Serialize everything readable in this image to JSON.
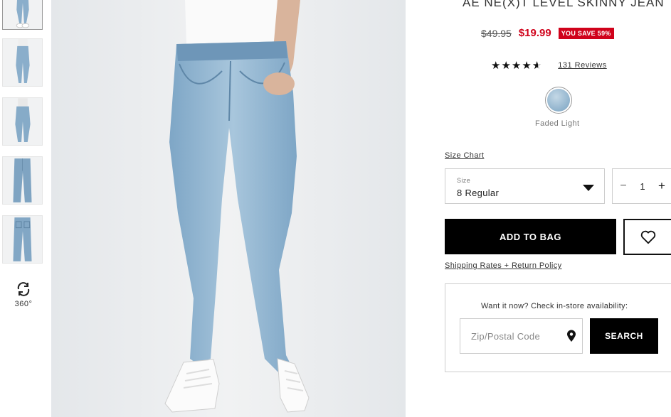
{
  "thumbnails": [
    {
      "name": "thumb-front-full",
      "active": true
    },
    {
      "name": "thumb-side",
      "active": false
    },
    {
      "name": "thumb-back",
      "active": false
    },
    {
      "name": "thumb-flat-front",
      "active": false
    },
    {
      "name": "thumb-flat-back",
      "active": false
    }
  ],
  "rotate": {
    "icon": "rotate-360-icon",
    "label": "360°"
  },
  "product": {
    "title": "AE NE(X)T LEVEL SKINNY JEAN",
    "old_price": "$49.95",
    "new_price": "$19.99",
    "save_badge": "YOU SAVE 59%",
    "rating": 4.5,
    "reviews_label": "131 Reviews",
    "color_name": "Faded Light"
  },
  "size": {
    "chart_link": "Size Chart",
    "label": "Size",
    "value": "8 Regular"
  },
  "quantity": {
    "minus": "−",
    "value": "1",
    "plus": "+"
  },
  "actions": {
    "add_to_bag": "ADD TO BAG",
    "shipping_link": "Shipping Rates + Return Policy"
  },
  "store": {
    "prompt": "Want it now? Check in-store availability:",
    "zip_placeholder": "Zip/Postal Code",
    "search_label": "SEARCH"
  },
  "colors": {
    "price_red": "#d0021b",
    "denim": "#8fb2cc",
    "button_black": "#000000"
  }
}
